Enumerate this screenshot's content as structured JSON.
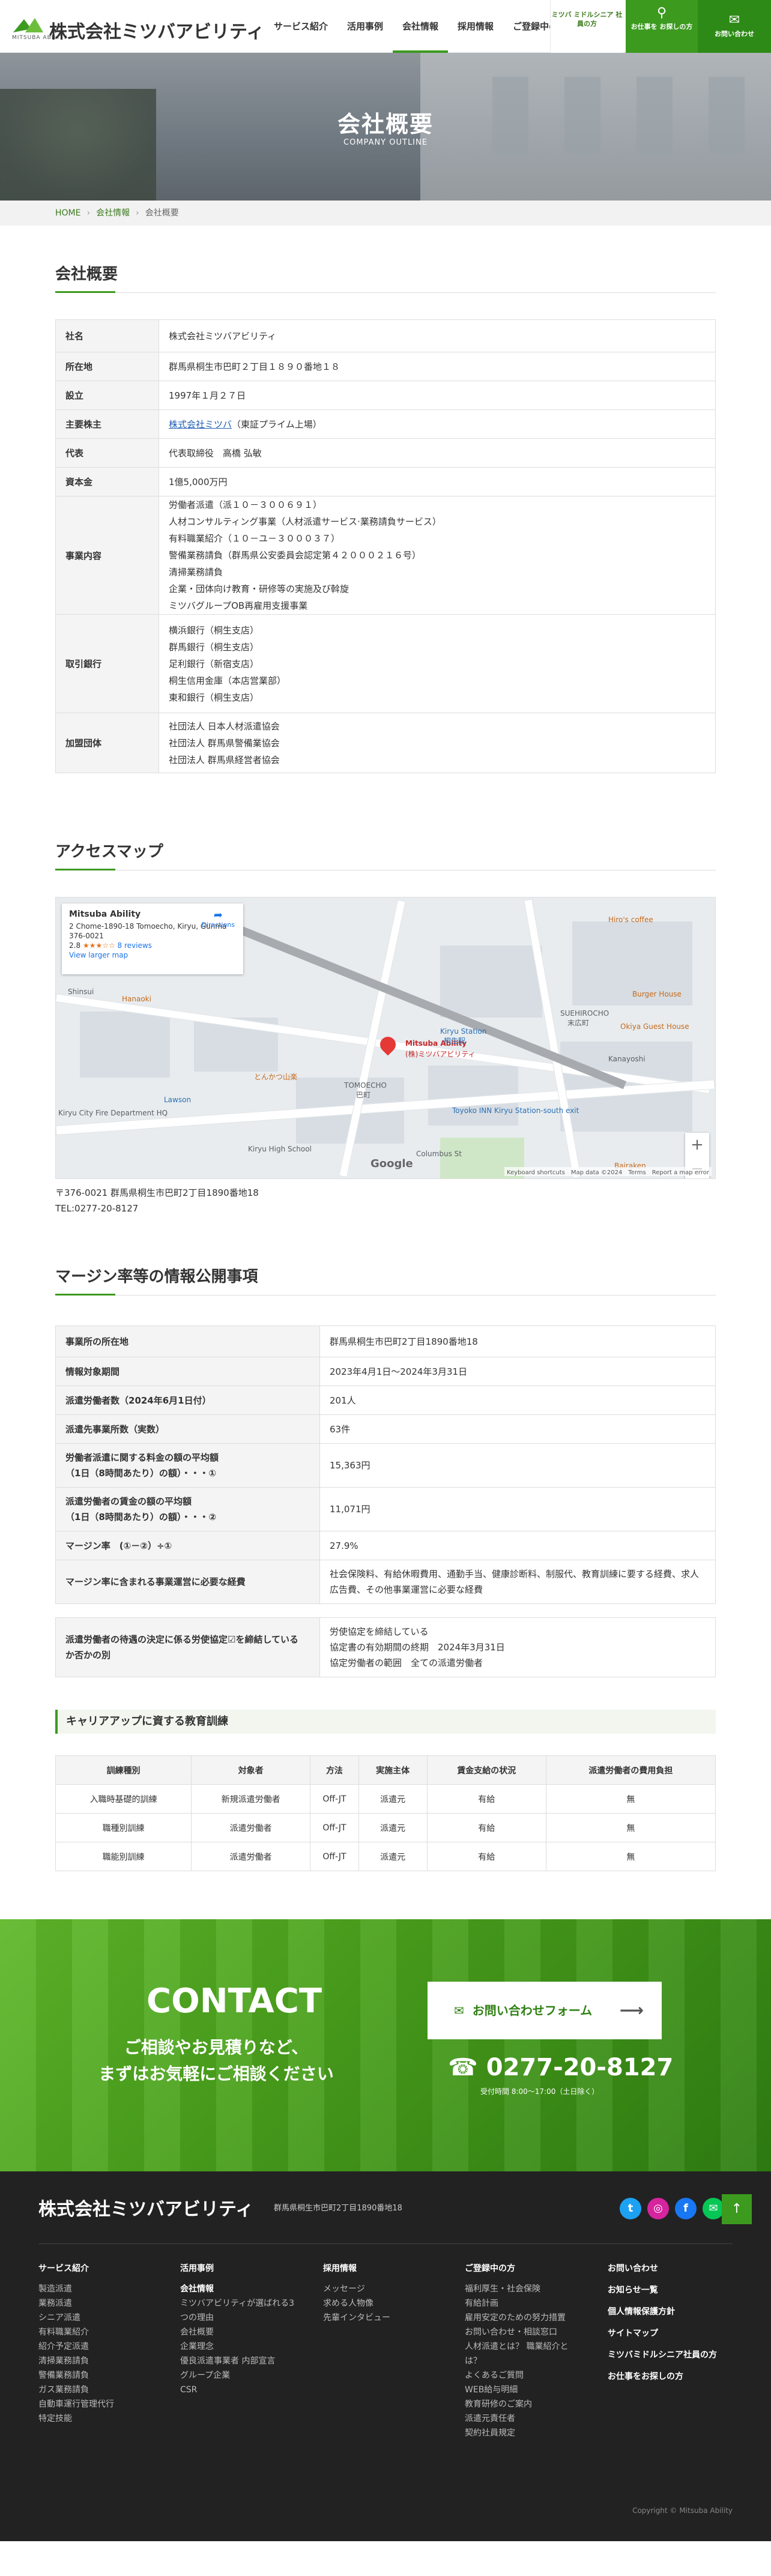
{
  "header": {
    "logo_text": "株式会社ミツバアビリティ",
    "logo_en": "MITSUBA ABILITY",
    "nav": [
      "サービス紹介",
      "活用事例",
      "会社情報",
      "採用情報",
      "ご登録中の方"
    ],
    "seniors_label": "ミツバ ミドルシニア 社員の方",
    "search_label": "お仕事を お探しの方",
    "contact_label": "お問い合わせ"
  },
  "hero": {
    "title": "会社概要",
    "subtitle": "COMPANY OUTLINE"
  },
  "breadcrumb": {
    "home": "HOME",
    "parent": "会社情報",
    "current": "会社概要",
    "sep": "›"
  },
  "outline": {
    "title": "会社概要",
    "rows": [
      {
        "label": "社名",
        "lines": [
          "株式会社ミツバアビリティ"
        ]
      },
      {
        "label": "所在地",
        "lines": [
          "群馬県桐生市巴町２丁目１８９０番地１８"
        ]
      },
      {
        "label": "設立",
        "lines": [
          "1997年１月２７日"
        ]
      },
      {
        "label": "主要株主",
        "link": "株式会社ミツバ",
        "link_suffix": "（東証プライム上場）"
      },
      {
        "label": "代表",
        "lines": [
          "代表取締役　高橋 弘敏"
        ]
      },
      {
        "label": "資本金",
        "lines": [
          "1億5,000万円"
        ]
      },
      {
        "label": "事業内容",
        "lines": [
          "労働者派遣（派１０－３００６９１）",
          "人材コンサルティング事業（人材派遣サービス·業務請負サービス）",
          "有料職業紹介（１０－ユ－３０００３７）",
          "警備業務請負（群馬県公安委員会認定第４２０００２１６号）",
          "清掃業務請負",
          "企業・団体向け教育・研修等の実施及び斡旋",
          "ミツバグループOB再雇用支援事業"
        ]
      },
      {
        "label": "取引銀行",
        "lines": [
          "横浜銀行（桐生支店）",
          "群馬銀行（桐生支店）",
          "足利銀行（新宿支店）",
          "桐生信用金庫（本店営業部）",
          "東和銀行（桐生支店）"
        ]
      },
      {
        "label": "加盟団体",
        "lines": [
          "社団法人 日本人材派遣協会",
          "社団法人 群馬県警備業協会",
          "社団法人 群馬県経営者協会"
        ]
      }
    ]
  },
  "access": {
    "title": "アクセスマップ",
    "map_card": {
      "name": "Mitsuba Ability",
      "address": "2 Chome-1890-18 Tomoecho, Kiryu, Gunma 376-0021",
      "rating": "2.8",
      "stars": "★★★☆☆",
      "reviews": "8 reviews",
      "larger": "View larger map",
      "directions": "Directions"
    },
    "map_labels": [
      "SUEHIROCHO",
      "末広町",
      "TOMOECHO",
      "巴町",
      "Kiryu Station",
      "桐生駅",
      "Mitsuba Ability",
      "(株)ミツバアビリティ",
      "Kiryu High School",
      "Toyoko INN Kiryu Station-south exit",
      "Burger House",
      "Okiya Guest House",
      "Hanaoki",
      "Lawson",
      "Kiryu City Fire Department HQ",
      "とんかつ山楽",
      "Bairaken",
      "Columbus St",
      "Shinsui",
      "Kanayoshi",
      "Hiro's coffee"
    ],
    "map_footer": "Keyboard shortcuts　Map data ©2024　Terms　Report a map error",
    "google": "Google",
    "postal": "〒376-0021 群馬県桐生市巴町2丁目1890番地18",
    "tel": "TEL:0277-20-8127"
  },
  "margin": {
    "title": "マージン率等の情報公開事項",
    "rows": [
      {
        "label": "事業所の所在地",
        "lines": [
          "群馬県桐生市巴町2丁目1890番地18"
        ]
      },
      {
        "label": "情報対象期間",
        "lines": [
          "2023年4月1日～2024年3月31日"
        ]
      },
      {
        "label": "派遣労働者数（2024年6月1日付）",
        "lines": [
          "201人"
        ]
      },
      {
        "label": "派遣先事業所数（実数）",
        "lines": [
          "63件"
        ]
      },
      {
        "label_lines": [
          "労働者派遣に関する料金の額の平均額",
          "（1日（8時間あたり）の額）・・・①"
        ],
        "lines": [
          "15,363円"
        ]
      },
      {
        "label_lines": [
          "派遣労働者の賃金の額の平均額",
          "（1日（8時間あたり）の額）・・・②"
        ],
        "lines": [
          "11,071円"
        ]
      },
      {
        "label": "マージン率　(①－②）÷①",
        "lines": [
          "27.9%"
        ]
      },
      {
        "label": "マージン率に含まれる事業運営に必要な経費",
        "lines": [
          "社会保険料、有給休暇費用、通勤手当、健康診断料、制服代、教育訓練に要する経費、求人広告費、その他事業運営に必要な経費"
        ]
      }
    ],
    "agreement": {
      "label_lines": [
        "派遣労働者の待遇の決定に係る労使協定☑を締結している",
        "か否かの別"
      ],
      "lines": [
        "労使協定を締結している",
        "協定書の有効期間の終期　2024年3月31日",
        "協定労働者の範囲　全ての派遣労働者"
      ]
    }
  },
  "training": {
    "title": "キャリアアップに資する教育訓練",
    "headers": [
      "訓練種別",
      "対象者",
      "方法",
      "実施主体",
      "賃金支給の状況",
      "派遣労働者の費用負担"
    ],
    "rows": [
      [
        "入職時基礎的訓練",
        "新規派遣労働者",
        "Off-JT",
        "派遣元",
        "有給",
        "無"
      ],
      [
        "職種別訓練",
        "派遣労働者",
        "Off-JT",
        "派遣元",
        "有給",
        "無"
      ],
      [
        "職能別訓練",
        "派遣労働者",
        "Off-JT",
        "派遣元",
        "有給",
        "無"
      ]
    ]
  },
  "contact": {
    "title": "CONTACT",
    "sub1": "ご相談やお見積りなど、",
    "sub2": "まずはお気軽にご相談ください",
    "form_button": "お問い合わせフォーム",
    "tel": "0277-20-8127",
    "hours": "受付時間 8:00～17:00（土日除く）"
  },
  "footer": {
    "logo": "株式会社ミツバアビリティ",
    "address": "群馬県桐生市巴町2丁目1890番地18",
    "col1": {
      "head": "サービス紹介",
      "items": [
        "製造派遣",
        "業務派遣",
        "シニア派遣",
        "有料職業紹介",
        "紹介予定派遣",
        "清掃業務請負",
        "警備業務請負",
        "ガス業務請負",
        "自動車運行管理代行",
        "特定技能"
      ]
    },
    "col2": {
      "head": "活用事例",
      "sub": "会社情報",
      "items": [
        "ミツバアビリティが選ばれる3つの理由",
        "会社概要",
        "企業理念",
        "優良派遣事業者 内部宣言",
        "グループ企業",
        "CSR"
      ]
    },
    "col3": {
      "head": "採用情報",
      "items": [
        "メッセージ",
        "求める人物像",
        "先輩インタビュー"
      ]
    },
    "col4": {
      "head": "ご登録中の方",
      "items": [
        "福利厚生・社会保険",
        "有給計画",
        "雇用安定のための努力措置",
        "お問い合わせ・相談窓口",
        "人材派遣とは？ 職業紹介とは？",
        "よくあるご質問",
        "WEB給与明細",
        "教育研修のご案内",
        "派遣元責任者",
        "契約社員規定"
      ]
    },
    "col5": [
      "お問い合わせ",
      "お知らせ一覧",
      "個人情報保護方針",
      "サイトマップ",
      "ミツバミドルシニア社員の方",
      "お仕事をお探しの方"
    ],
    "sns": {
      "twitter": "twitter-icon",
      "instagram": "instagram-icon",
      "facebook": "facebook-icon",
      "line": "line-icon"
    },
    "copyright": "Copyright © Mitsuba Ability"
  }
}
